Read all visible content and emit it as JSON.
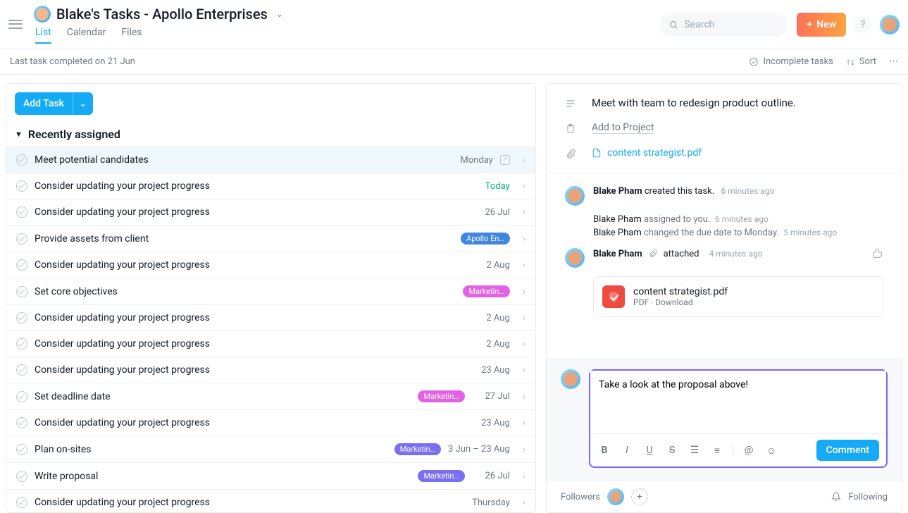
{
  "header": {
    "title": "Blake's Tasks - Apollo Enterprises",
    "tabs": [
      {
        "label": "List",
        "active": true
      },
      {
        "label": "Calendar",
        "active": false
      },
      {
        "label": "Files",
        "active": false
      }
    ],
    "search_placeholder": "Search",
    "new_label": "New"
  },
  "subbar": {
    "status": "Last task completed on 21 Jun",
    "filter": "Incomplete tasks",
    "sort": "Sort"
  },
  "add_task_label": "Add Task",
  "section_title": "Recently assigned",
  "tasks": [
    {
      "name": "Meet potential candidates",
      "due": "Monday",
      "selected": true,
      "show_cal": true
    },
    {
      "name": "Consider updating your project progress",
      "due": "Today",
      "due_class": "today"
    },
    {
      "name": "Consider updating your project progress",
      "due": "26 Jul"
    },
    {
      "name": "Provide assets from client",
      "tag": "Apollo En…",
      "tag_color": "#4186e0"
    },
    {
      "name": "Consider updating your project progress",
      "due": "2 Aug"
    },
    {
      "name": "Set core objectives",
      "tag": "Marketin…",
      "tag_color": "#e362e3"
    },
    {
      "name": "Consider updating your project progress",
      "due": "2 Aug"
    },
    {
      "name": "Consider updating your project progress",
      "due": "2 Aug"
    },
    {
      "name": "Consider updating your project progress",
      "due": "23 Aug"
    },
    {
      "name": "Set deadline date",
      "tag": "Marketin…",
      "tag_color": "#e362e3",
      "due": "27 Jul"
    },
    {
      "name": "Consider updating your project progress",
      "due": "23 Aug"
    },
    {
      "name": "Plan on-sites",
      "tag": "Marketin…",
      "tag_color": "#7a6ff0",
      "due": "3 Jun – 23 Aug"
    },
    {
      "name": "Write proposal",
      "tag": "Marketin…",
      "tag_color": "#7a6ff0",
      "due": "26 Jul"
    },
    {
      "name": "Consider updating your project progress",
      "due": "Thursday"
    }
  ],
  "detail": {
    "description": "Meet with team to redesign product outline.",
    "add_to_project": "Add to Project",
    "attachment": "content strategist.pdf",
    "activity_created": {
      "actor": "Blake Pham",
      "action": "created this task.",
      "time": "6 minutes ago"
    },
    "sublines": [
      {
        "pre": "Blake Pham",
        "rest": " assigned to you.",
        "time": "6 minutes ago"
      },
      {
        "pre": "Blake Pham",
        "rest": " changed the due date to Monday.",
        "time": "5 minutes ago"
      }
    ],
    "activity_attached": {
      "actor": "Blake Pham",
      "action": "attached",
      "time": "4 minutes ago"
    },
    "attach_card": {
      "name": "content strategist.pdf",
      "meta": "PDF · Download"
    },
    "comment_value": "Take a look at the proposal above!",
    "comment_button": "Comment",
    "followers_label": "Followers",
    "following_label": "Following"
  }
}
